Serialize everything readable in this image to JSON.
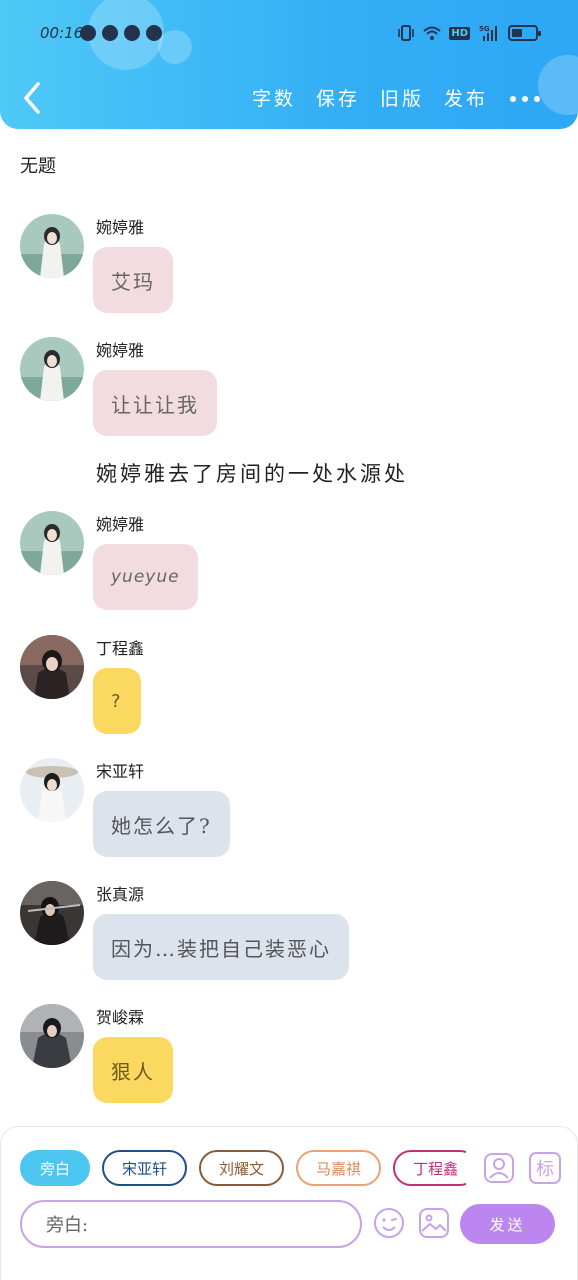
{
  "status_bar": {
    "time": "00:16",
    "network_badge": "HD",
    "network_type": "5G"
  },
  "header": {
    "back_icon": "chevron-left-icon",
    "toolbar": [
      {
        "label": "字数"
      },
      {
        "label": "保存"
      },
      {
        "label": "旧版"
      },
      {
        "label": "发布"
      }
    ],
    "more_icon": "more-dots-icon"
  },
  "story": {
    "title": "无题"
  },
  "messages": [
    {
      "sender": "婉婷雅",
      "text": "艾玛",
      "style": "pink",
      "avatar": "avatar-wantingya"
    },
    {
      "sender": "婉婷雅",
      "text": "让让让我",
      "style": "pink",
      "avatar": "avatar-wantingya"
    },
    {
      "sender": "婉婷雅",
      "text": "yueyue",
      "style": "pink",
      "avatar": "avatar-wantingya"
    },
    {
      "sender": "丁程鑫",
      "text": "?",
      "style": "yellow",
      "avatar": "avatar-dingchengxin"
    },
    {
      "sender": "宋亚轩",
      "text": "她怎么了?",
      "style": "blue",
      "avatar": "avatar-songyaxuan"
    },
    {
      "sender": "张真源",
      "text": "因为…装把自己装恶心",
      "style": "blue",
      "avatar": "avatar-zhangzhenyuan"
    },
    {
      "sender": "贺峻霖",
      "text": "狠人",
      "style": "yellow",
      "avatar": "avatar-hejunlin"
    }
  ],
  "narration": {
    "text": "婉婷雅去了房间的一处水源处"
  },
  "composer": {
    "chips": [
      {
        "label": "旁白",
        "active": true,
        "color": "#4cc6f0"
      },
      {
        "label": "宋亚轩",
        "active": false,
        "color": "#1f4f8a"
      },
      {
        "label": "刘耀文",
        "active": false,
        "color": "#8a5a3a"
      },
      {
        "label": "马嘉祺",
        "active": false,
        "color": "#f0a070"
      },
      {
        "label": "丁程鑫",
        "active": false,
        "color": "#c0307a"
      }
    ],
    "input_prefix": "旁白:",
    "send_label": "发送",
    "icons": [
      "character-icon",
      "label-icon",
      "emoji-icon",
      "image-icon"
    ],
    "side_label": "标"
  }
}
